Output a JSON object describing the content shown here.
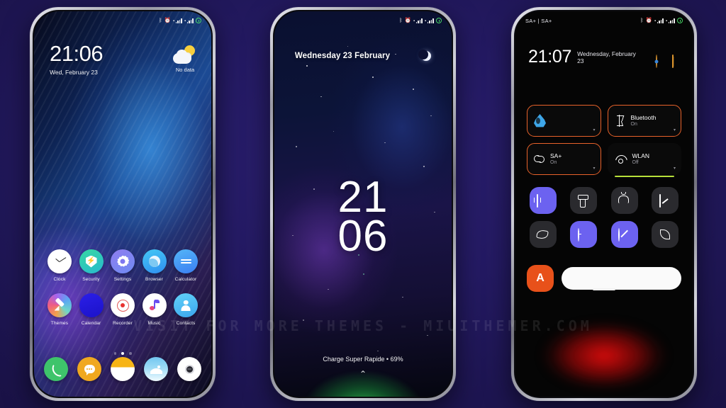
{
  "watermark": "VISIT FOR MORE THEMES - MIUITHEMER.COM",
  "colors": {
    "background_start": "#2b1f72",
    "background_end": "#1a1248",
    "accent_orange": "#e8622a",
    "accent_purple": "#6c62f0",
    "accent_green": "#b7e03a",
    "charge_green": "#3ce65a",
    "glow_red": "#e10c0c"
  },
  "phone1": {
    "name": "Home Screen",
    "statusbar": {
      "left": "",
      "icons": [
        "bluetooth-icon",
        "alarm-icon",
        "sim1-signal-icon",
        "sim2-signal-icon",
        "battery-icon"
      ]
    },
    "clock": {
      "time": "21:06",
      "date": "Wed, February 23"
    },
    "weather": {
      "icon": "partly-cloudy-icon",
      "status": "No data"
    },
    "apps_row1": [
      {
        "label": "Clock",
        "icon": "clock-app-icon"
      },
      {
        "label": "Security",
        "icon": "security-app-icon"
      },
      {
        "label": "Settings",
        "icon": "settings-app-icon"
      },
      {
        "label": "Browser",
        "icon": "browser-app-icon"
      },
      {
        "label": "Calculator",
        "icon": "calculator-app-icon"
      }
    ],
    "apps_row2": [
      {
        "label": "Themes",
        "icon": "themes-app-icon"
      },
      {
        "label": "Calendar",
        "icon": "calendar-app-icon"
      },
      {
        "label": "Recorder",
        "icon": "recorder-app-icon"
      },
      {
        "label": "Music",
        "icon": "music-app-icon"
      },
      {
        "label": "Contacts",
        "icon": "contacts-app-icon"
      }
    ],
    "page_indicator": {
      "total": 3,
      "active": 2
    },
    "dock": [
      {
        "label": "Phone",
        "icon": "phone-dock-icon"
      },
      {
        "label": "Messages",
        "icon": "messages-dock-icon"
      },
      {
        "label": "Notes",
        "icon": "notes-dock-icon"
      },
      {
        "label": "Gallery",
        "icon": "gallery-dock-icon"
      },
      {
        "label": "Camera",
        "icon": "camera-dock-icon"
      }
    ]
  },
  "phone2": {
    "name": "Lock Screen",
    "statusbar": {
      "icons": [
        "bluetooth-icon",
        "alarm-icon",
        "sim1-signal-icon",
        "sim2-signal-icon",
        "battery-icon"
      ]
    },
    "date_text": "Wednesday 23 February",
    "moon_icon": "moon-icon",
    "clock_hours": "21",
    "clock_minutes": "06",
    "charge_status": "Charge Super Rapide • 69%",
    "unlock_chevron": "chevron-up-icon"
  },
  "phone3": {
    "name": "Quick Settings",
    "statusbar": {
      "carrier": "SA+ | SA+",
      "icons": [
        "bluetooth-icon",
        "alarm-icon",
        "sim1-signal-icon",
        "sim2-signal-icon",
        "battery-icon"
      ]
    },
    "time": "21:07",
    "date": "Wednesday, February 23",
    "header_icons": [
      {
        "name": "settings-gear-icon"
      },
      {
        "name": "edit-tiles-icon"
      }
    ],
    "big_tiles": [
      {
        "title": "",
        "subtitle": "",
        "icon": "mobile-data-icon",
        "state": "on",
        "has_underbar": false
      },
      {
        "title": "Bluetooth",
        "subtitle": "On",
        "icon": "bluetooth-tile-icon",
        "state": "on",
        "has_underbar": false
      },
      {
        "title": "SA+",
        "subtitle": "On",
        "icon": "sa-plus-icon",
        "state": "on",
        "has_underbar": false
      },
      {
        "title": "WLAN",
        "subtitle": "Off",
        "icon": "wlan-icon",
        "state": "off",
        "has_underbar": true
      }
    ],
    "mini_tiles": [
      {
        "icon": "vibrate-icon",
        "active": true
      },
      {
        "icon": "flashlight-icon",
        "active": false
      },
      {
        "icon": "ringer-bell-icon",
        "active": false
      },
      {
        "icon": "screenshot-icon",
        "active": false
      },
      {
        "icon": "eye-care-icon",
        "active": false
      },
      {
        "icon": "auto-rotate-clock-icon",
        "active": true
      },
      {
        "icon": "do-not-disturb-icon",
        "active": true
      },
      {
        "icon": "battery-saver-leaf-icon",
        "active": false
      }
    ],
    "brightness_row": {
      "app_shortcut_label": "A",
      "app_shortcut_icon": "brightness-auto-icon",
      "slider_name": "brightness-slider"
    }
  }
}
